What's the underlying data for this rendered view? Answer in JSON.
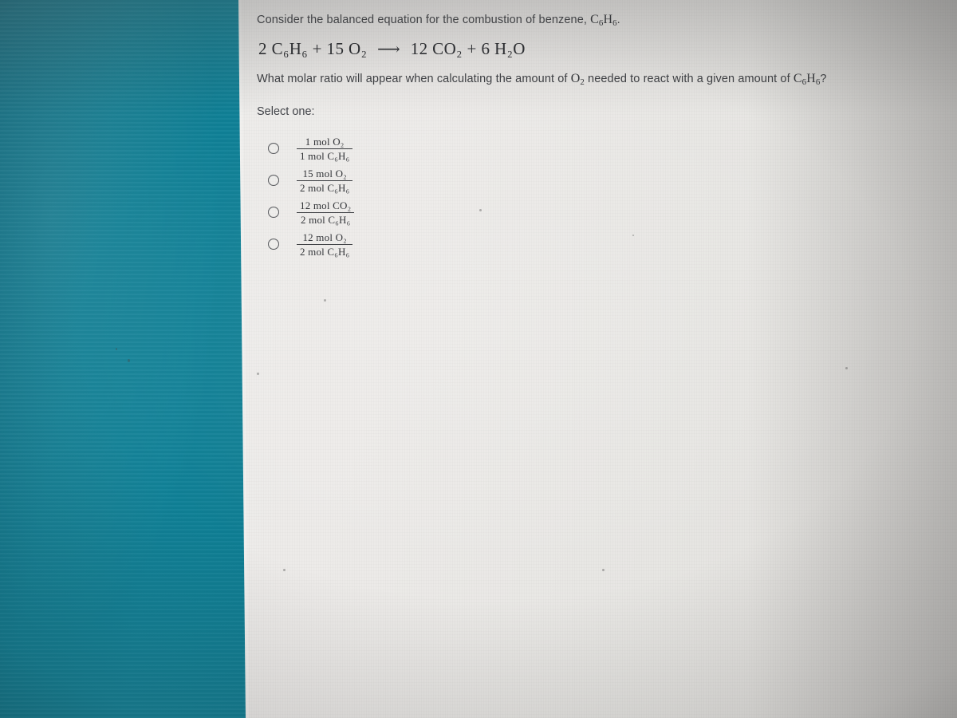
{
  "colors": {
    "teal_band": "#0d7d93",
    "paper": "#ebeae8",
    "text": "#3a3c40",
    "equation_text": "#26282c",
    "radio_outline": "#55575b"
  },
  "question": {
    "intro_prefix": "Consider the balanced equation for the combustion of benzene,",
    "intro_formula_c": "C",
    "intro_formula_c_sub": "6",
    "intro_formula_h": "H",
    "intro_formula_h_sub": "6",
    "intro_suffix": ".",
    "equation": {
      "left_coeff_1": "2",
      "left_species_1": "C₆H₆",
      "plus_1": "+",
      "left_coeff_2": "15",
      "left_species_2": "O₂",
      "arrow": "⟶",
      "right_coeff_1": "12",
      "right_species_1": "CO₂",
      "plus_2": "+",
      "right_coeff_2": "6",
      "right_species_2": "H₂O",
      "full_text": "2 C6H6 + 15 O2 ⟶ 12 CO2 + 6 H2O"
    },
    "prompt_part_1": "What molar ratio will appear when calculating the amount of",
    "prompt_o2": "O",
    "prompt_o2_sub": "2",
    "prompt_part_2": "needed to react with a given amount of",
    "prompt_c6h6_c": "C",
    "prompt_c6h6_c_sub": "6",
    "prompt_c6h6_h": "H",
    "prompt_c6h6_h_sub": "6",
    "prompt_end": "?"
  },
  "select_label": "Select one:",
  "options": [
    {
      "id": "option-a",
      "numerator": "1 mol O₂",
      "denominator": "1 mol C₆H₆",
      "selected": false
    },
    {
      "id": "option-b",
      "numerator": "15 mol O₂",
      "denominator": "2 mol C₆H₆",
      "selected": false
    },
    {
      "id": "option-c",
      "numerator": "12 mol CO₂",
      "denominator": "2 mol C₆H₆",
      "selected": false
    },
    {
      "id": "option-d",
      "numerator": "12 mol O₂",
      "denominator": "2 mol C₆H₆",
      "selected": false
    }
  ]
}
